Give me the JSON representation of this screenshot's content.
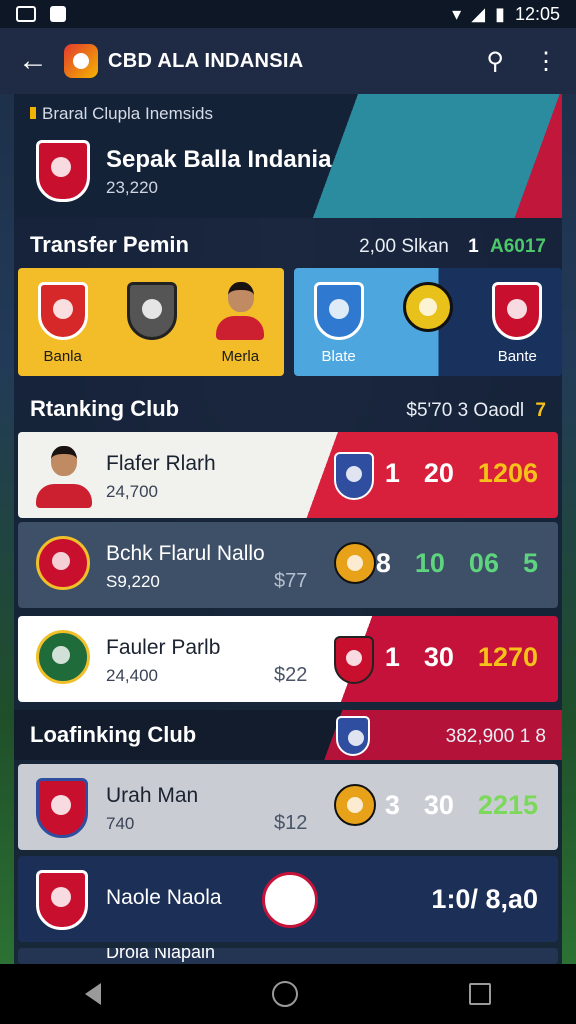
{
  "status": {
    "time": "12:05"
  },
  "app_bar": {
    "title": "CBD ALA INDANSIA",
    "back_icon": "arrow-left-icon",
    "search_icon": "search-icon",
    "menu_icon": "more-vert-icon"
  },
  "hero": {
    "kicker": "Braral Clupla Inemsids",
    "name": "Sepak Balla Indania",
    "value": "23,220"
  },
  "transfer": {
    "title": "Transfer Pemin",
    "meta": "2,00 Slkan",
    "code_num": "1",
    "code": "A6017",
    "left_card": {
      "items": [
        {
          "label": "Banla"
        },
        {
          "label": ""
        },
        {
          "label": "Merla"
        }
      ]
    },
    "right_card": {
      "items": [
        {
          "label": "Blate"
        },
        {
          "label": ""
        },
        {
          "label": "Bante"
        }
      ]
    }
  },
  "ranking": {
    "title": "Rtanking Club",
    "meta": "$5'70 3 Oaodl",
    "meta_accent": "7",
    "rows": [
      {
        "name": "Flafer Rlarh",
        "sub": "24,700",
        "price": "",
        "stats": [
          "1",
          "20",
          "1206"
        ]
      },
      {
        "name": "Bchk Flarul Nallo",
        "sub": "S9,220",
        "price": "$77",
        "stats": [
          "8",
          "10",
          "06",
          "5"
        ]
      },
      {
        "name": "Fauler Parlb",
        "sub": "24,400",
        "price": "$22",
        "stats": [
          "1",
          "30",
          "1270"
        ]
      }
    ]
  },
  "leading": {
    "title": "Loafinking Club",
    "meta": "382,900 1 8",
    "rows": [
      {
        "name": "Urah Man",
        "sub": "740",
        "price": "$12",
        "stats": [
          "3",
          "30",
          "2215"
        ]
      },
      {
        "name": "Naole Naola",
        "sub": "",
        "price": "",
        "stats": [
          "1:0/ 8,a0"
        ]
      },
      {
        "name": "Drola Nlapain",
        "sub": "",
        "price": "",
        "stats": []
      }
    ]
  },
  "colors": {
    "green": "#4cc76a",
    "gold": "#f5c21a",
    "red": "#d81f3b",
    "navy": "#1f2b45"
  }
}
